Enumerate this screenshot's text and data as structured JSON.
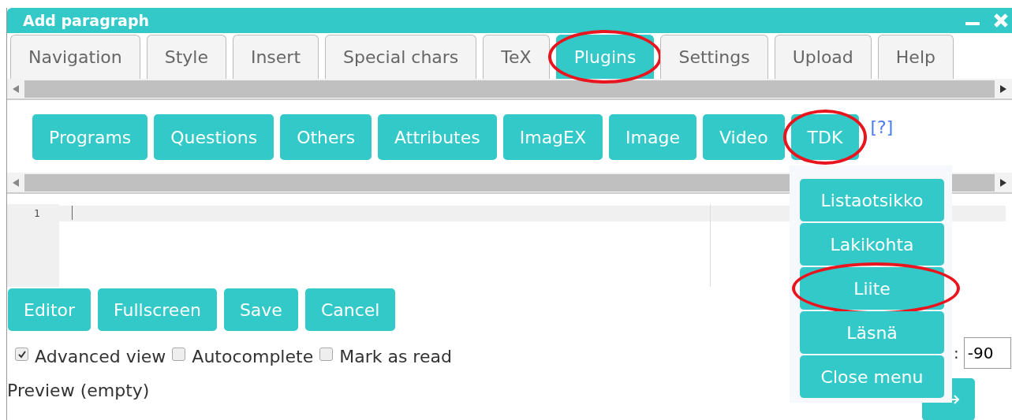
{
  "window": {
    "title": "Add paragraph"
  },
  "tabs": [
    {
      "label": "Navigation",
      "selected": false,
      "highlighted": false
    },
    {
      "label": "Style",
      "selected": false,
      "highlighted": false
    },
    {
      "label": "Insert",
      "selected": false,
      "highlighted": false
    },
    {
      "label": "Special chars",
      "selected": false,
      "highlighted": false
    },
    {
      "label": "TeX",
      "selected": false,
      "highlighted": false
    },
    {
      "label": "Plugins",
      "selected": true,
      "highlighted": true
    },
    {
      "label": "Settings",
      "selected": false,
      "highlighted": false
    },
    {
      "label": "Upload",
      "selected": false,
      "highlighted": false
    },
    {
      "label": "Help",
      "selected": false,
      "highlighted": false
    }
  ],
  "plugin_buttons": [
    {
      "label": "Programs",
      "highlighted": false
    },
    {
      "label": "Questions",
      "highlighted": false
    },
    {
      "label": "Others",
      "highlighted": false
    },
    {
      "label": "Attributes",
      "highlighted": false
    },
    {
      "label": "ImagEX",
      "highlighted": false
    },
    {
      "label": "Image",
      "highlighted": false
    },
    {
      "label": "Video",
      "highlighted": false
    },
    {
      "label": "TDK",
      "highlighted": true
    }
  ],
  "help_link": "[?]",
  "editor": {
    "line_numbers": [
      "1"
    ]
  },
  "action_buttons": [
    "Editor",
    "Fullscreen",
    "Save",
    "Cancel"
  ],
  "options": [
    {
      "label": "Advanced view",
      "checked": true
    },
    {
      "label": "Autocomplete",
      "checked": false
    },
    {
      "label": "Mark as read",
      "checked": false
    }
  ],
  "preview_label": "Preview (empty)",
  "angle_field": {
    "label": ":",
    "value": "-90"
  },
  "tdk_menu": {
    "items": [
      {
        "label": "Listaotsikko",
        "highlighted": false
      },
      {
        "label": "Lakikohta",
        "highlighted": false
      },
      {
        "label": "Liite",
        "highlighted": true
      },
      {
        "label": "Läsnä",
        "highlighted": false
      },
      {
        "label": "Close menu",
        "highlighted": false
      }
    ]
  }
}
